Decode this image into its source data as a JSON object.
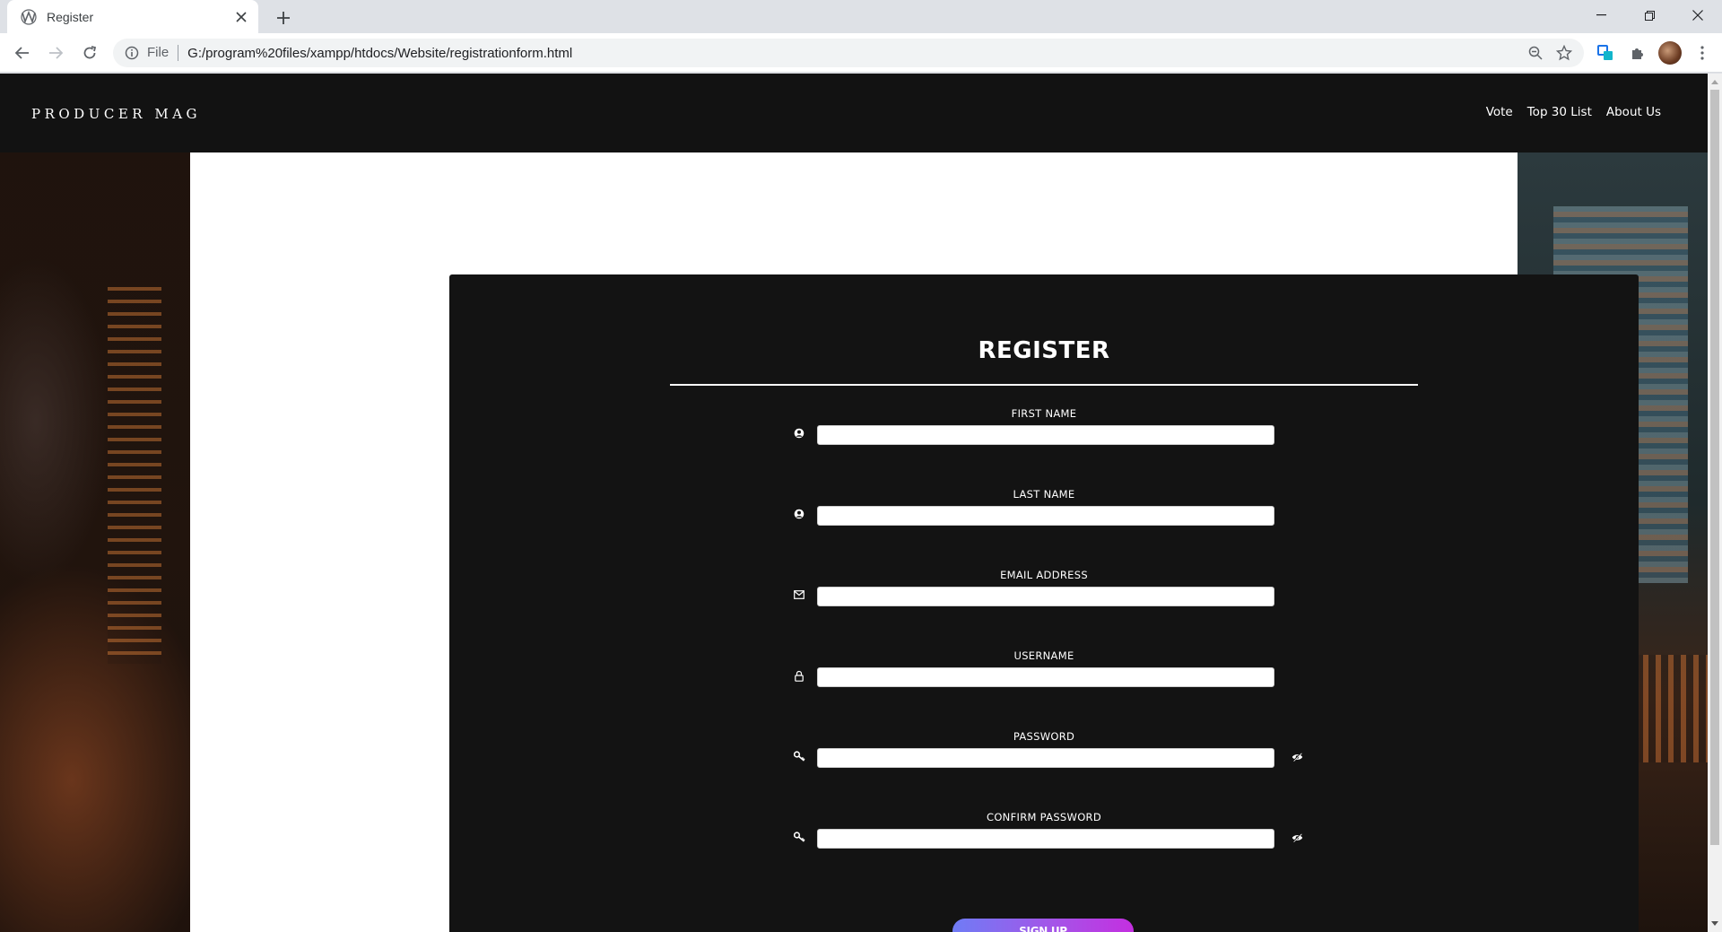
{
  "browser": {
    "tab_title": "Register",
    "omnibox_scheme_label": "File",
    "url": "G:/program%20files/xampp/htdocs/Website/registrationform.html",
    "icons": [
      "back-icon",
      "forward-icon",
      "reload-icon",
      "info-icon",
      "zoom-icon",
      "star-icon",
      "extension-icon",
      "puzzle-icon",
      "avatar",
      "menu-icon"
    ]
  },
  "site": {
    "brand": "PRODUCER MAG",
    "nav": [
      {
        "label": "Vote"
      },
      {
        "label": "Top 30 List"
      },
      {
        "label": "About Us"
      }
    ]
  },
  "form": {
    "title": "REGISTER",
    "fields": [
      {
        "label": "FIRST NAME",
        "icon": "user-circle-icon",
        "value": ""
      },
      {
        "label": "LAST NAME",
        "icon": "user-circle-icon",
        "value": ""
      },
      {
        "label": "EMAIL ADDRESS",
        "icon": "envelope-icon",
        "value": ""
      },
      {
        "label": "USERNAME",
        "icon": "lock-icon",
        "value": ""
      },
      {
        "label": "PASSWORD",
        "icon": "key-icon",
        "value": "",
        "toggle": "eye-slash-icon"
      },
      {
        "label": "CONFIRM PASSWORD",
        "icon": "key-icon",
        "value": "",
        "toggle": "eye-slash-icon"
      }
    ],
    "submit_label": "SIGN UP"
  },
  "colors": {
    "header_bg": "#121212",
    "card_bg": "#131313",
    "button_gradient_start": "#6f7cf5",
    "button_gradient_end": "#c42fe0"
  }
}
